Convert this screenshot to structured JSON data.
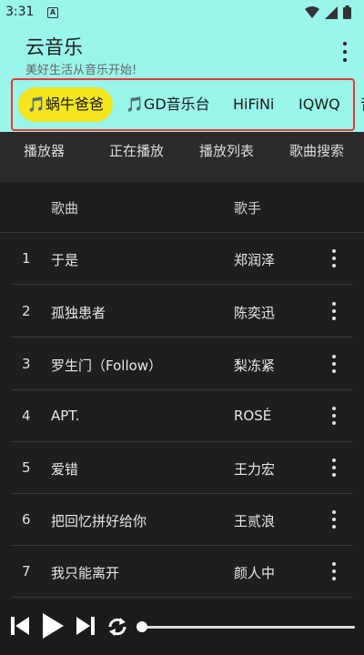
{
  "status_bar": {
    "time": "3:31",
    "notification_badge": "A",
    "icons": [
      "wifi-icon",
      "signal-icon",
      "battery-icon"
    ]
  },
  "app": {
    "title": "云音乐",
    "subtitle": "美好生活从音乐开始!"
  },
  "sources": [
    {
      "label": "🎵蜗牛爸爸",
      "active": true
    },
    {
      "label": "🎵GD音乐台",
      "active": false
    },
    {
      "label": "HiFiNi",
      "active": false
    },
    {
      "label": "IQWQ",
      "active": false
    },
    {
      "label": "音",
      "active": false
    }
  ],
  "menu": [
    "播放器",
    "正在播放",
    "播放列表",
    "歌曲搜索"
  ],
  "table": {
    "headers": {
      "song": "歌曲",
      "artist": "歌手"
    },
    "rows": [
      {
        "index": "1",
        "title": "于是",
        "artist": "郑润泽"
      },
      {
        "index": "2",
        "title": "孤独患者",
        "artist": "陈奕迅"
      },
      {
        "index": "3",
        "title": "罗生门（Follow）",
        "artist": "梨冻紧"
      },
      {
        "index": "4",
        "title": "APT.",
        "artist": "ROSÉ"
      },
      {
        "index": "5",
        "title": "爱错",
        "artist": "王力宏"
      },
      {
        "index": "6",
        "title": "把回忆拼好给你",
        "artist": "王贰浪"
      },
      {
        "index": "7",
        "title": "我只能离开",
        "artist": "颜人中"
      }
    ]
  },
  "player": {
    "progress": 0.0
  },
  "colors": {
    "top_background": "#9af5ea",
    "active_tab": "#f4e61d",
    "highlight_border": "#e53935",
    "list_background": "#1e1e1e"
  }
}
